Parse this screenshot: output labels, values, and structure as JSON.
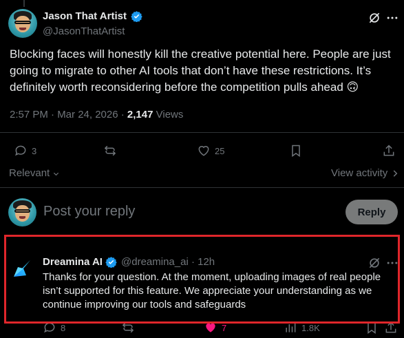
{
  "tweet": {
    "author_name": "Jason That Artist",
    "author_handle": "@JasonThatArtist",
    "text": "Blocking faces will honestly kill the creative potential here. People are just going to migrate to other AI tools that don’t have these restrictions. It’s definitely worth reconsidering before the competition pulls ahead 🙃",
    "time": "2:57 PM · Mar 24, 2026 · ",
    "views_count": "2,147",
    "views_label": " Views",
    "stats": {
      "replies": "3",
      "likes": "25"
    }
  },
  "sort": {
    "label": "Relevant",
    "view_activity": "View activity"
  },
  "composer": {
    "placeholder": "Post your reply",
    "button_label": "Reply"
  },
  "reply": {
    "author_name": "Dreamina AI",
    "author_handle": "@dreamina_ai",
    "time": " · 12h",
    "text": "Thanks for your question. At the moment, uploading images of real people isn’t supported for this feature.  We appreciate your understanding as we continue improving our tools and safeguards",
    "stats": {
      "replies": "8",
      "likes": "7",
      "views": "1.8K"
    }
  },
  "colors": {
    "background": "#000000",
    "verified": "#1d9bf0",
    "highlight": "#e0262b",
    "like": "#f91880"
  },
  "icons": [
    "verified-icon",
    "grok-icon",
    "more-icon",
    "reply-icon",
    "repost-icon",
    "like-icon",
    "bookmark-icon",
    "share-icon",
    "chevron-down-icon",
    "arrow-right-icon"
  ]
}
